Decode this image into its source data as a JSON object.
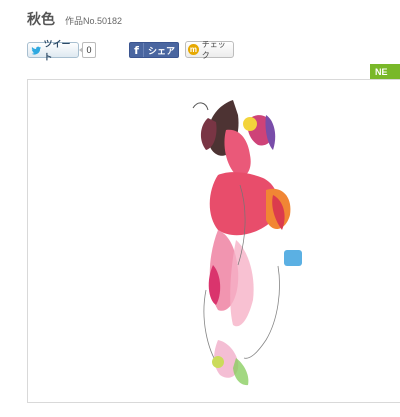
{
  "artwork": {
    "title": "秋色",
    "work_number": "作品No.50182"
  },
  "share": {
    "tweet_label": "ツイート",
    "tweet_count": "0",
    "facebook_label": "シェア",
    "mixi_check_label": "チェック"
  },
  "badge": {
    "new_label": "NE"
  },
  "colors": {
    "new_badge": "#79b829",
    "facebook": "#4a66a0"
  }
}
